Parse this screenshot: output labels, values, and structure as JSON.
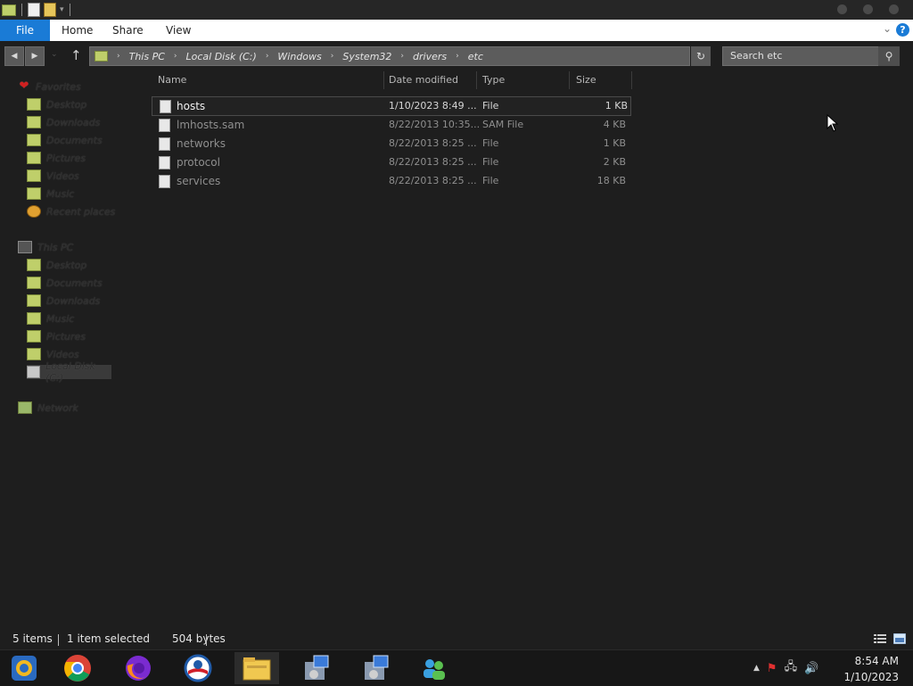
{
  "window": {
    "quick_access": [
      "properties-icon",
      "new-folder-icon",
      "customize-arrow-icon"
    ]
  },
  "ribbon": {
    "file": "File",
    "tabs": [
      "Home",
      "Share",
      "View"
    ],
    "help": "?"
  },
  "navigation": {
    "breadcrumbs": [
      "This PC",
      "Local Disk (C:)",
      "Windows",
      "System32",
      "drivers",
      "etc"
    ],
    "search_placeholder": "Search etc"
  },
  "nav_pane": {
    "favorites_label": "Favorites",
    "favorites": [
      "Desktop",
      "Downloads",
      "Documents",
      "Pictures",
      "Videos",
      "Music",
      "Recent places"
    ],
    "this_pc_label": "This PC",
    "this_pc": [
      "Desktop",
      "Documents",
      "Downloads",
      "Music",
      "Pictures",
      "Videos",
      "Local Disk (C:)"
    ],
    "network_label": "Network"
  },
  "file_list": {
    "columns": [
      "Name",
      "Date modified",
      "Type",
      "Size"
    ],
    "rows": [
      {
        "name": "hosts",
        "date": "1/10/2023 8:49 ...",
        "type": "File",
        "size": "1 KB",
        "selected": true
      },
      {
        "name": "lmhosts.sam",
        "date": "8/22/2013 10:35...",
        "type": "SAM File",
        "size": "4 KB",
        "selected": false
      },
      {
        "name": "networks",
        "date": "8/22/2013 8:25 ...",
        "type": "File",
        "size": "1 KB",
        "selected": false
      },
      {
        "name": "protocol",
        "date": "8/22/2013 8:25 ...",
        "type": "File",
        "size": "2 KB",
        "selected": false
      },
      {
        "name": "services",
        "date": "8/22/2013 8:25 ...",
        "type": "File",
        "size": "18 KB",
        "selected": false
      }
    ]
  },
  "status_bar": {
    "items_count": "5 items",
    "selection": "1 item selected",
    "selection_size": "504 bytes"
  },
  "taskbar": {
    "apps": [
      "settings-app-icon",
      "chrome-icon",
      "firefox-icon",
      "obama-logo-icon",
      "file-explorer-icon",
      "installer-icon",
      "installer-icon-2",
      "users-icon"
    ],
    "clock_time": "8:54 AM",
    "clock_date": "1/10/2023"
  },
  "colors": {
    "accent": "#1a7bd6",
    "background": "#1e1e1e"
  }
}
